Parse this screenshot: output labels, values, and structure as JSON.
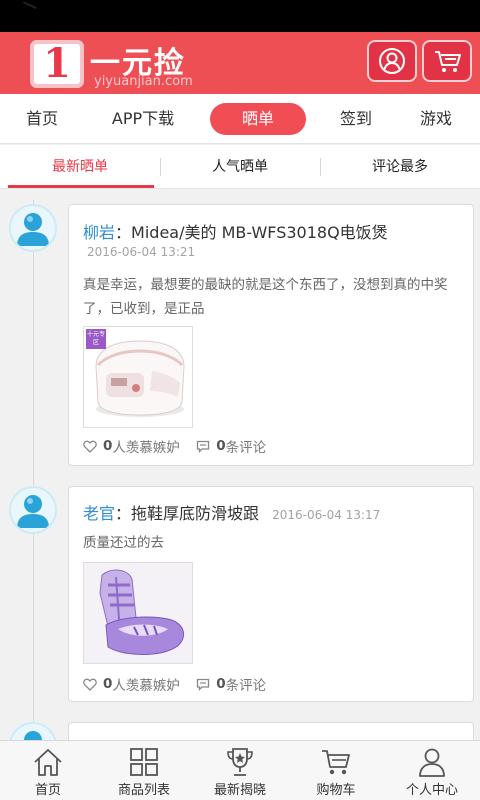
{
  "app": {
    "logo_digit": "1",
    "logo_cn": "一元捡",
    "logo_en": "yiyuanjian.com"
  },
  "header_icons": [
    "user-icon",
    "cart-icon"
  ],
  "nav": {
    "items": [
      {
        "label": "首页",
        "active": false
      },
      {
        "label": "APP下载",
        "active": false
      },
      {
        "label": "晒单",
        "active": true
      },
      {
        "label": "签到",
        "active": false
      },
      {
        "label": "游戏",
        "active": false
      }
    ]
  },
  "subtabs": {
    "items": [
      {
        "label": "最新晒单",
        "active": true
      },
      {
        "label": "人气晒单",
        "active": false
      },
      {
        "label": "评论最多",
        "active": false
      }
    ]
  },
  "posts": [
    {
      "user": "柳岩",
      "separator": "：",
      "title": "Midea/美的 MB-WFS3018Q电饭煲",
      "time": "2016-06-04 13:21",
      "text": "真是幸运，最想要的最缺的就是这个东西了，没想到真的中奖了，已收到，是正品",
      "image_badge": "十元专区",
      "likes_count": "0",
      "likes_label": "人羡慕嫉妒",
      "comments_count": "0",
      "comments_label": "条评论"
    },
    {
      "user": "老官",
      "separator": "：",
      "title": "拖鞋厚底防滑坡跟",
      "time": "2016-06-04 13:17",
      "text": "质量还过的去",
      "likes_count": "0",
      "likes_label": "人羡慕嫉妒",
      "comments_count": "0",
      "comments_label": "条评论"
    }
  ],
  "tabbar": {
    "items": [
      {
        "label": "首页",
        "icon": "home-icon"
      },
      {
        "label": "商品列表",
        "icon": "grid-icon"
      },
      {
        "label": "最新揭晓",
        "icon": "trophy-icon"
      },
      {
        "label": "购物车",
        "icon": "cart-icon"
      },
      {
        "label": "个人中心",
        "icon": "person-icon"
      }
    ]
  },
  "colors": {
    "brand_red": "#ee4f55",
    "active_tab": "#f04d55",
    "link_blue": "#2f8fd3"
  }
}
